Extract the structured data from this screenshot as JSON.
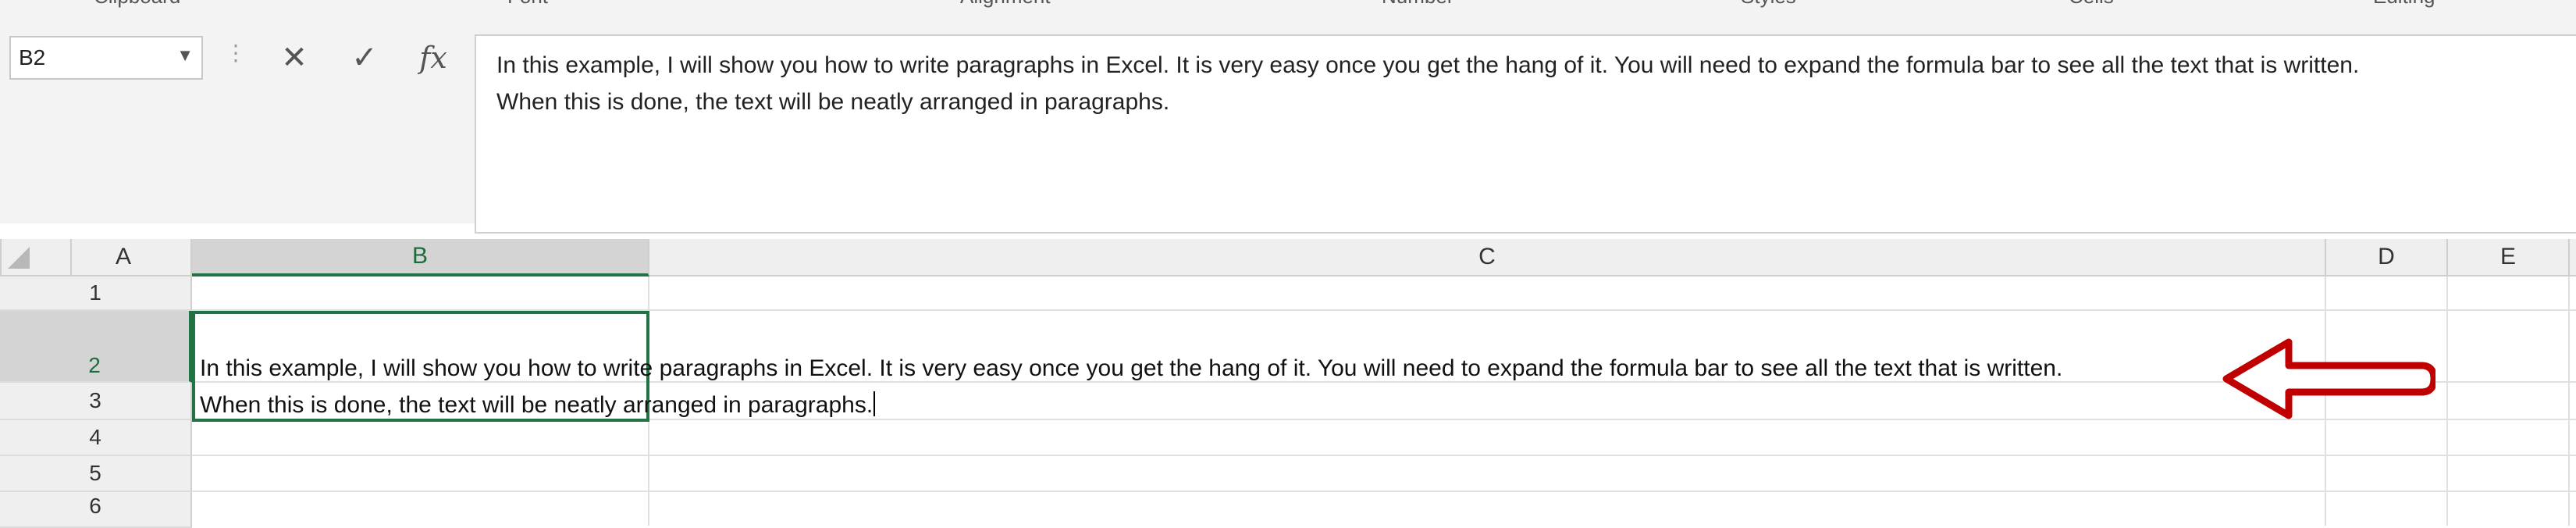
{
  "ribbon": {
    "groups": [
      "Clipboard",
      "Font",
      "Alignment",
      "Number",
      "Styles",
      "Cells",
      "Editing"
    ]
  },
  "name_box": {
    "value": "B2"
  },
  "formula_bar": {
    "cancel_glyph": "✕",
    "enter_glyph": "✓",
    "fx_label": "fx",
    "line1": "In this example, I will show you how to write paragraphs in Excel. It is very easy once you get the hang of it. You will need to expand the formula bar to see all the text that is written.",
    "line2": "When this is done, the text will be neatly arranged in paragraphs."
  },
  "columns": [
    "A",
    "B",
    "C",
    "D",
    "E"
  ],
  "rows": [
    "1",
    "2",
    "3",
    "4",
    "5",
    "6"
  ],
  "selected_cell": {
    "column": "B",
    "row": "2"
  },
  "cell_b2": {
    "line1": "In this example, I will show you how to write paragraphs in Excel. It is very easy once you get the hang of it. You will need to expand the formula bar to see all the text that is written.",
    "line2": "When this is done, the text will be neatly arranged in paragraphs."
  },
  "annotation": {
    "color": "#c00000",
    "icon": "left-arrow-annotation"
  },
  "colors": {
    "accent": "#217346"
  }
}
